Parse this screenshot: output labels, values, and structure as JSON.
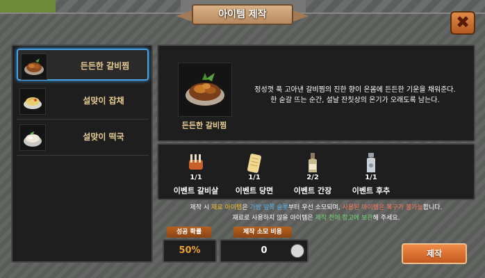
{
  "window": {
    "title": "아이템 제작",
    "close_icon": "x-icon"
  },
  "recipes": [
    {
      "label": "든든한 갈비찜",
      "icon": "galbijjim-icon",
      "selected": true
    },
    {
      "label": "설맞이 잡채",
      "icon": "japchae-icon",
      "selected": false
    },
    {
      "label": "설맞이 떡국",
      "icon": "tteokguk-icon",
      "selected": false
    }
  ],
  "detail": {
    "name": "든든한 갈비찜",
    "description_line1": "정성껏 푹 고아낸 갈비찜의 진한 향이 온몸에 든든한 기운을 채워준다.",
    "description_line2": "한 숟갈 뜨는 순간, 설날 잔칫상의 온기가 오래도록 남는다."
  },
  "materials": [
    {
      "name": "이벤트 갈비살",
      "count": "1/1",
      "icon": "rib-meat-icon"
    },
    {
      "name": "이벤트 당면",
      "count": "1/1",
      "icon": "glass-noodle-icon"
    },
    {
      "name": "이벤트 간장",
      "count": "2/2",
      "icon": "soy-sauce-icon"
    },
    {
      "name": "이벤트 후추",
      "count": "1/1",
      "icon": "pepper-icon"
    }
  ],
  "notice": {
    "l1_a": "제작 시 ",
    "l1_b": "재료 아이템",
    "l1_c": "은 ",
    "l1_d": "가방 앞쪽 슬롯",
    "l1_e": "부터 우선 소모되며, ",
    "l1_f": "사용된 아이템은 복구가 불가능",
    "l1_g": "합니다.",
    "l2_a": "재료로 사용하지 않을 아이템은 ",
    "l2_b": "제작 전에 창고에 보관",
    "l2_c": "해 주세요."
  },
  "stats": {
    "success_label": "성공 확률",
    "success_value": "50%",
    "cost_label": "제작 소모 비용",
    "cost_value": "0",
    "cost_icon": "coin-icon"
  },
  "craft_button": "제작",
  "colors": {
    "accent": "#e07a3a",
    "selection": "#4a9fe0",
    "name_gold": "#e8cf94"
  }
}
